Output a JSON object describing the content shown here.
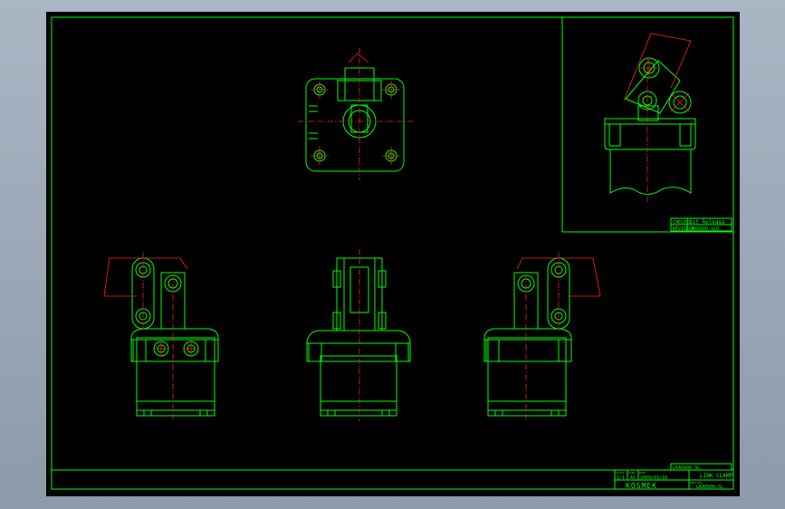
{
  "drawing": {
    "inset_block": {
      "row1": "CHECKED",
      "row1_value": "1st Release",
      "row2": "REVISION",
      "row2_value": "LKA0900-SLR"
    },
    "title_block": {
      "drawing_no_top": "LKA0900-SL",
      "scale_label": "SCALE",
      "scale": "1/1",
      "size_label": "SIZE",
      "size": "A1",
      "date_label": "DATE",
      "date": "2009/03/10",
      "title": "LINK CLAMP",
      "part_label": "PART NO.",
      "part_no": "LKA0900-SL",
      "logo": "KOSMEK"
    }
  }
}
